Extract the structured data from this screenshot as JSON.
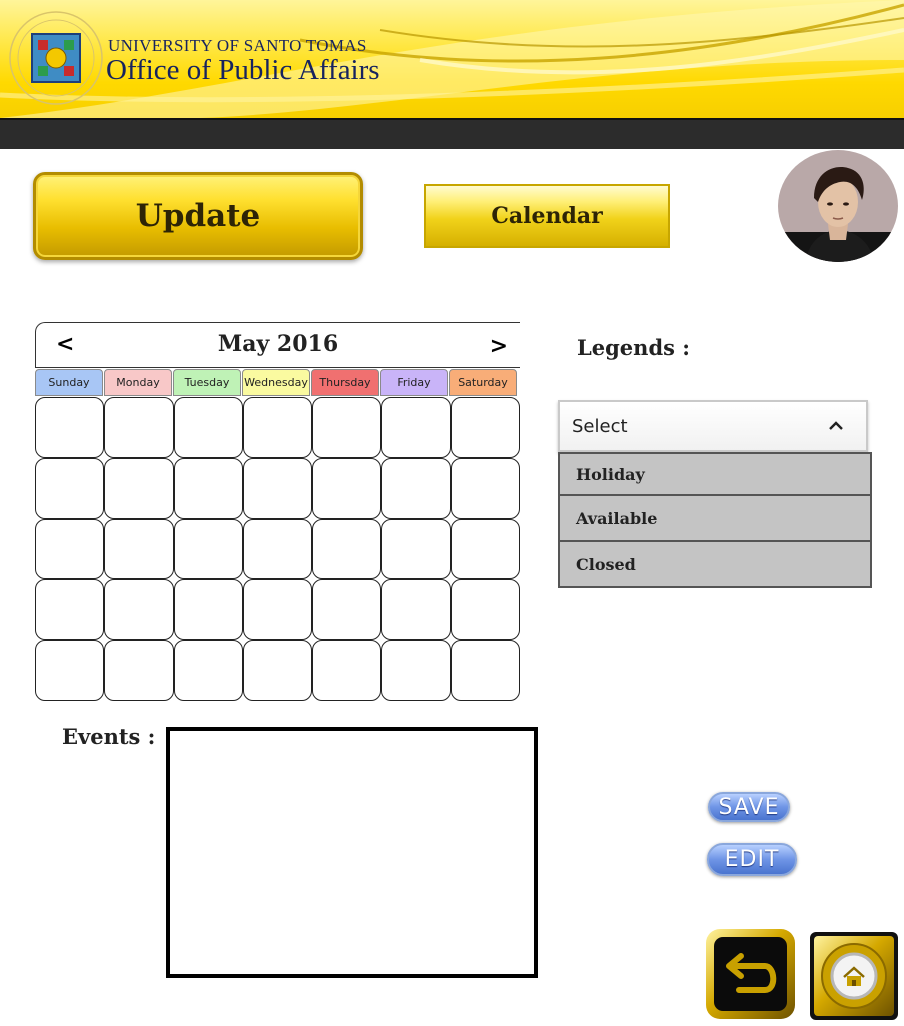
{
  "header": {
    "university": "UNIVERSITY OF SANTO TOMAS",
    "office": "Office of Public Affairs"
  },
  "buttons": {
    "update": "Update",
    "calendar": "Calendar",
    "save": "SAVE",
    "edit": "EDIT"
  },
  "calendar": {
    "prev": "<",
    "next": ">",
    "month_label": "May 2016",
    "days": [
      {
        "label": "Sunday",
        "color": "#a8c6f5"
      },
      {
        "label": "Monday",
        "color": "#f8c8c8"
      },
      {
        "label": "Tuesday",
        "color": "#bff2b6"
      },
      {
        "label": "Wednesday",
        "color": "#fafaa0"
      },
      {
        "label": "Thursday",
        "color": "#f07070"
      },
      {
        "label": "Friday",
        "color": "#c9b4f8"
      },
      {
        "label": "Saturday",
        "color": "#f8ad78"
      }
    ],
    "rows": 5
  },
  "legends": {
    "label": "Legends :",
    "select_value": "Select",
    "options": [
      "Holiday",
      "Available",
      "Closed"
    ]
  },
  "events": {
    "label": "Events :"
  },
  "icons": {
    "seal": "university-seal-icon",
    "back": "back-arrow-icon",
    "home": "home-icon",
    "caret": "chevron-up-icon"
  },
  "colors": {
    "header_yellow": "#ffd900",
    "header_text": "#16235f",
    "dark_bar": "#2c2c2c",
    "gold": "#e8bd00"
  }
}
